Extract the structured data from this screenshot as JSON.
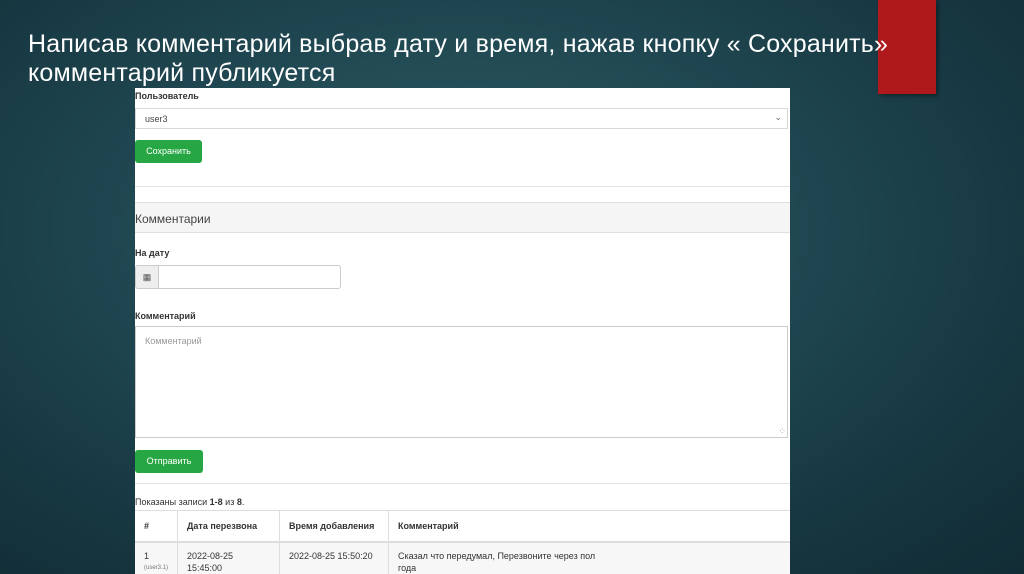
{
  "slide": {
    "title_line1": "Написав комментарий выбрав дату и время, нажав кнопку « Сохранить»",
    "title_line2": "комментарий публикуется"
  },
  "form": {
    "user_label": "Пользователь",
    "user_value": "user3",
    "save_label": "Сохранить"
  },
  "comments_panel": {
    "title": "Комментарии",
    "date_label": "На дату",
    "comment_label": "Комментарий",
    "comment_placeholder": "Комментарий",
    "submit_label": "Отправить"
  },
  "summary": {
    "prefix": "Показаны записи ",
    "range": "1-8",
    "middle": " из ",
    "total": "8",
    "suffix": "."
  },
  "table": {
    "headers": [
      "#",
      "Дата перезвона",
      "Время добавления",
      "Комментарий"
    ],
    "rows": [
      {
        "num": "1",
        "num_sub": "(user3.1)",
        "callback_date": "2022-08-25",
        "callback_time": "15:45:00",
        "added": "2022-08-25 15:50:20",
        "comment_line1": "Сказал что передумал, Перезвоните через пол",
        "comment_line2": "года"
      }
    ]
  },
  "colors": {
    "accent_red": "#b0191b",
    "button_green": "#27a744",
    "background": "#1f4650"
  },
  "icons": {
    "calendar": "calendar-icon",
    "dropdown": "chevron-down-icon",
    "resize": "resize-grip-icon"
  }
}
